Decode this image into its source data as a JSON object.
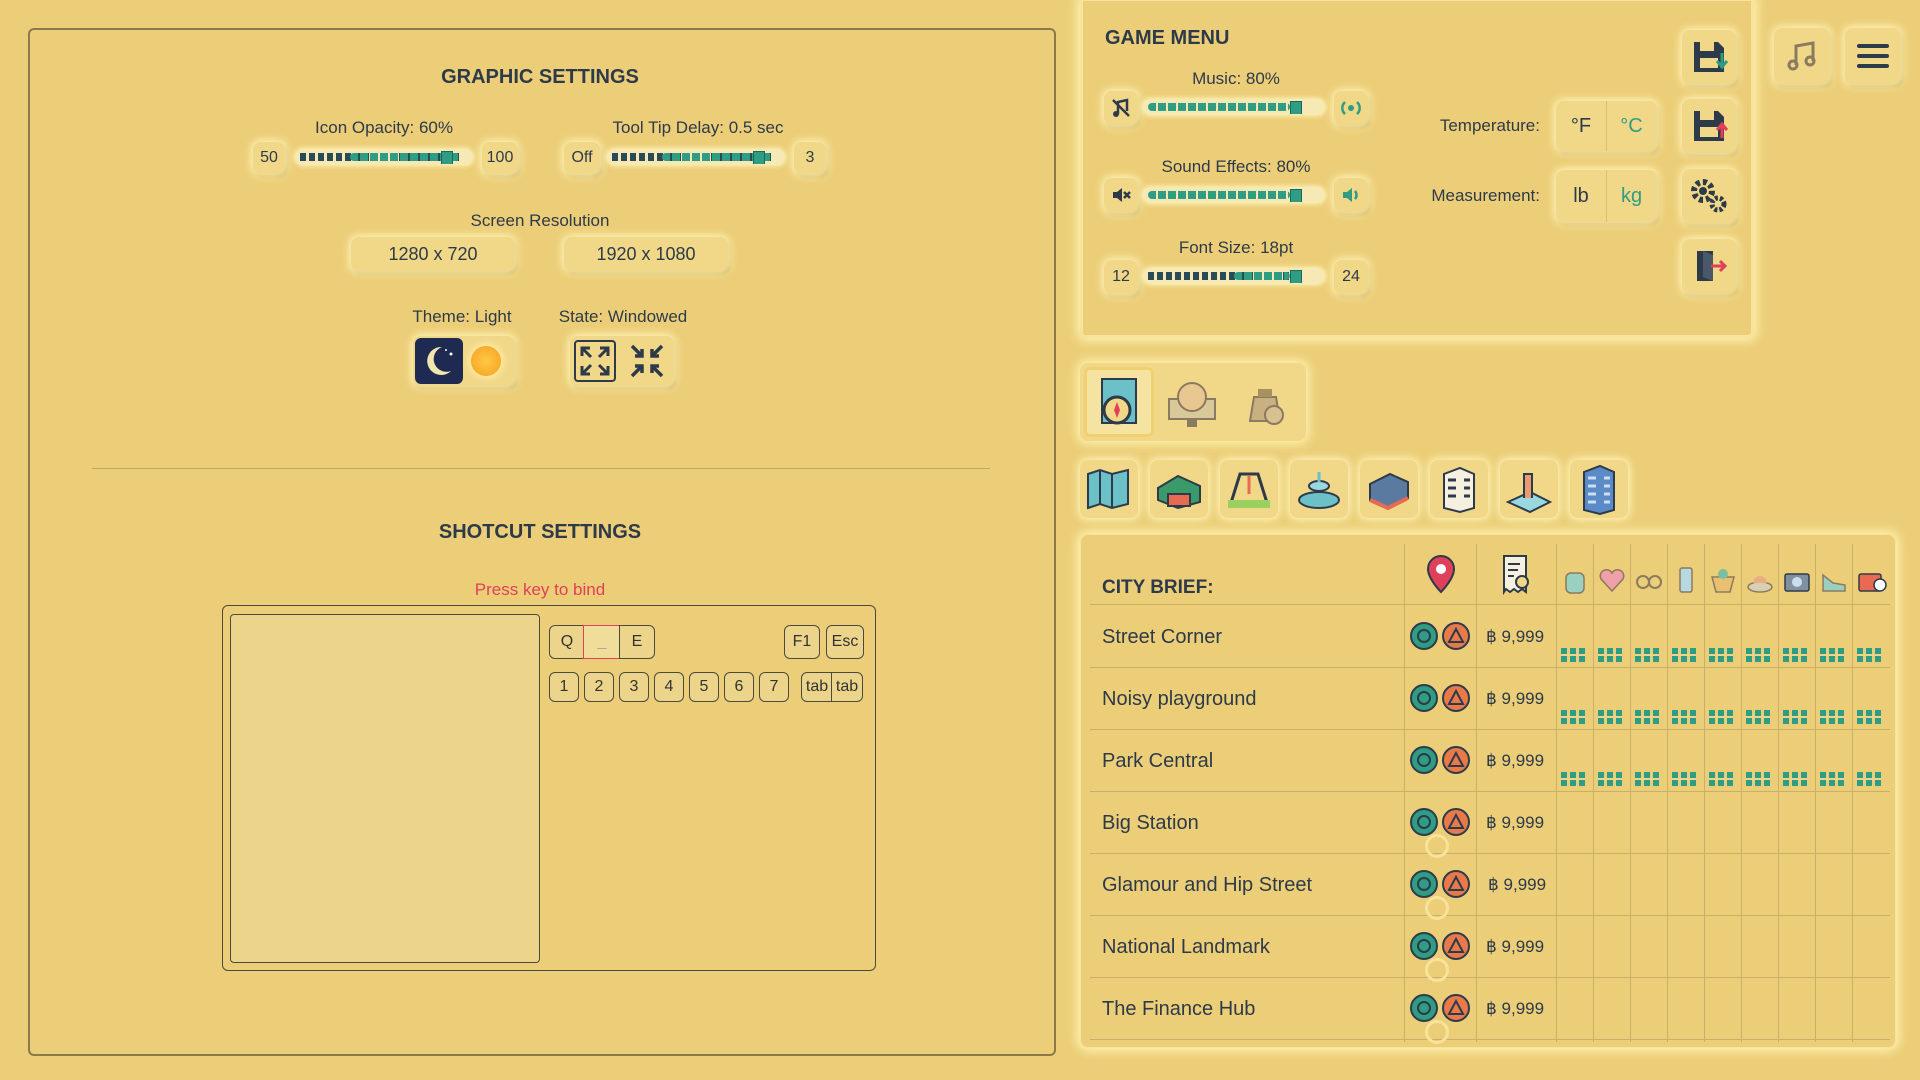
{
  "graphic": {
    "title": "GRAPHIC SETTINGS",
    "icon_opacity_label": "Icon Opacity: 60%",
    "icon_opacity_min": "50",
    "icon_opacity_max": "100",
    "icon_opacity_value": 0.6,
    "tooltip_label": "Tool Tip Delay: 0.5 sec",
    "tooltip_min": "Off",
    "tooltip_max": "3",
    "resolution_label": "Screen Resolution",
    "res_option_1": "1280 x 720",
    "res_option_2": "1920 x 1080",
    "theme_label": "Theme: Light",
    "state_label": "State: Windowed"
  },
  "shortcut": {
    "title": "SHOTCUT SETTINGS",
    "hint": "Press key to bind",
    "keys_row1": [
      "Q",
      "_",
      "E"
    ],
    "keys_fn": [
      "F1",
      "Esc"
    ],
    "keys_row2": [
      "1",
      "2",
      "3",
      "4",
      "5",
      "6",
      "7",
      "tab",
      "tab"
    ]
  },
  "game_menu": {
    "title": "GAME MENU",
    "music_label": "Music: 80%",
    "sfx_label": "Sound Effects: 80%",
    "font_label": "Font Size: 18pt",
    "font_min": "12",
    "font_max": "24",
    "temperature_label": "Temperature:",
    "temp_f": "°F",
    "temp_c": "°C",
    "measurement_label": "Measurement:",
    "meas_lb": "lb",
    "meas_kg": "kg"
  },
  "city_brief": {
    "title": "CITY BRIEF:",
    "rows": [
      {
        "name": "Street Corner",
        "price": "฿ 9,999"
      },
      {
        "name": "Noisy playground",
        "price": "฿ 9,999"
      },
      {
        "name": "Park Central",
        "price": "฿ 9,999"
      },
      {
        "name": "Big Station",
        "price": "฿ 9,999"
      },
      {
        "name": "Glamour and Hip Street",
        "price": "฿ 9,999"
      },
      {
        "name": "National Landmark",
        "price": "฿ 9,999"
      },
      {
        "name": "The Finance Hub",
        "price": "฿ 9,999"
      }
    ]
  },
  "colors": {
    "background": "#ecce78",
    "accent": "#2f9c84",
    "alert": "#e0405a"
  },
  "icons": [
    "music-icon",
    "menu-icon",
    "save-icon",
    "load-icon",
    "gear-icon",
    "exit-icon",
    "moon-icon",
    "sun-icon",
    "fullscreen-icon",
    "windowed-icon",
    "map-icon",
    "globe-icon",
    "money-icon",
    "location-pin-icon",
    "receipt-icon"
  ]
}
